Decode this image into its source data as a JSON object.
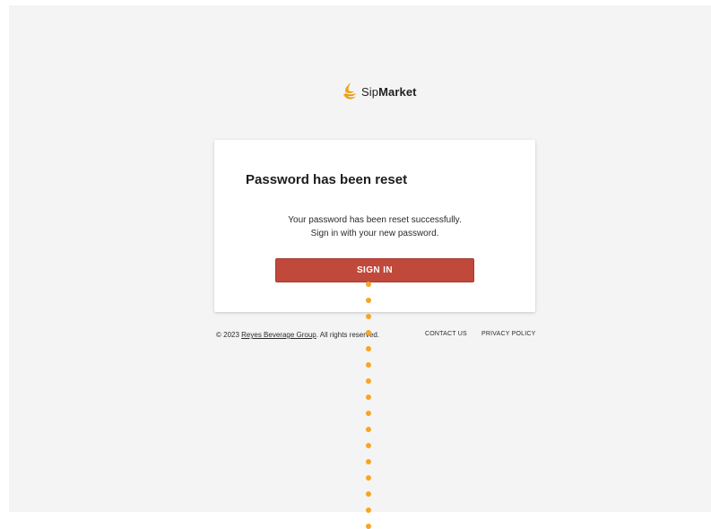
{
  "brand": {
    "name_light": "Sip",
    "name_bold": "Market",
    "logo_icon": "sipmarket-drop-icon",
    "color": "#f0a51c"
  },
  "card": {
    "title": "Password has been reset",
    "message_line1": "Your password has been reset successfully.",
    "message_line2": "Sign in with your new password.",
    "signin_label": "SIGN IN",
    "button_color": "#c0493b"
  },
  "footer": {
    "copyright_prefix": "© 2023 ",
    "company_link": "Reyes Beverage Group",
    "copyright_suffix": ". All rights reserved.",
    "contact_label": "CONTACT US",
    "privacy_label": "PRIVACY POLICY"
  },
  "overlay": {
    "trail_color": "#f6a623"
  }
}
